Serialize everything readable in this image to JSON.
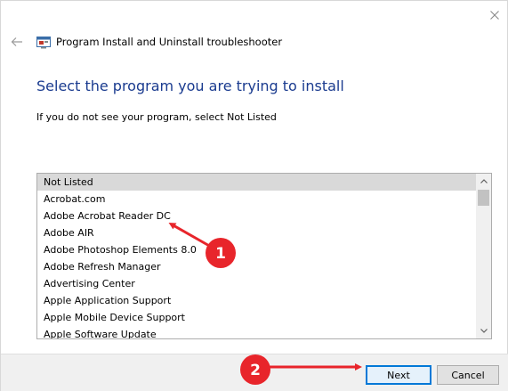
{
  "window": {
    "title": "Program Install and Uninstall troubleshooter"
  },
  "icons": {
    "close": "close-icon",
    "back": "back-arrow-icon",
    "app": "troubleshooter-icon"
  },
  "main": {
    "heading": "Select the program you are trying to install",
    "instruction": "If you do not see your program, select Not Listed"
  },
  "program_list": {
    "selected_index": 0,
    "items": [
      "Not Listed",
      "Acrobat.com",
      "Adobe Acrobat Reader DC",
      "Adobe AIR",
      "Adobe Photoshop Elements 8.0",
      "Adobe Refresh Manager",
      "Advertising Center",
      "Apple Application Support",
      "Apple Mobile Device Support",
      "Apple Software Update"
    ]
  },
  "buttons": {
    "next": "Next",
    "cancel": "Cancel"
  },
  "annotations": [
    {
      "label": "1",
      "color": "#e8252b"
    },
    {
      "label": "2",
      "color": "#e8252b"
    }
  ],
  "colors": {
    "heading": "#1a3b8f",
    "selection": "#d9d9d9",
    "focus_border": "#0078d7",
    "annotation": "#e8252b"
  }
}
